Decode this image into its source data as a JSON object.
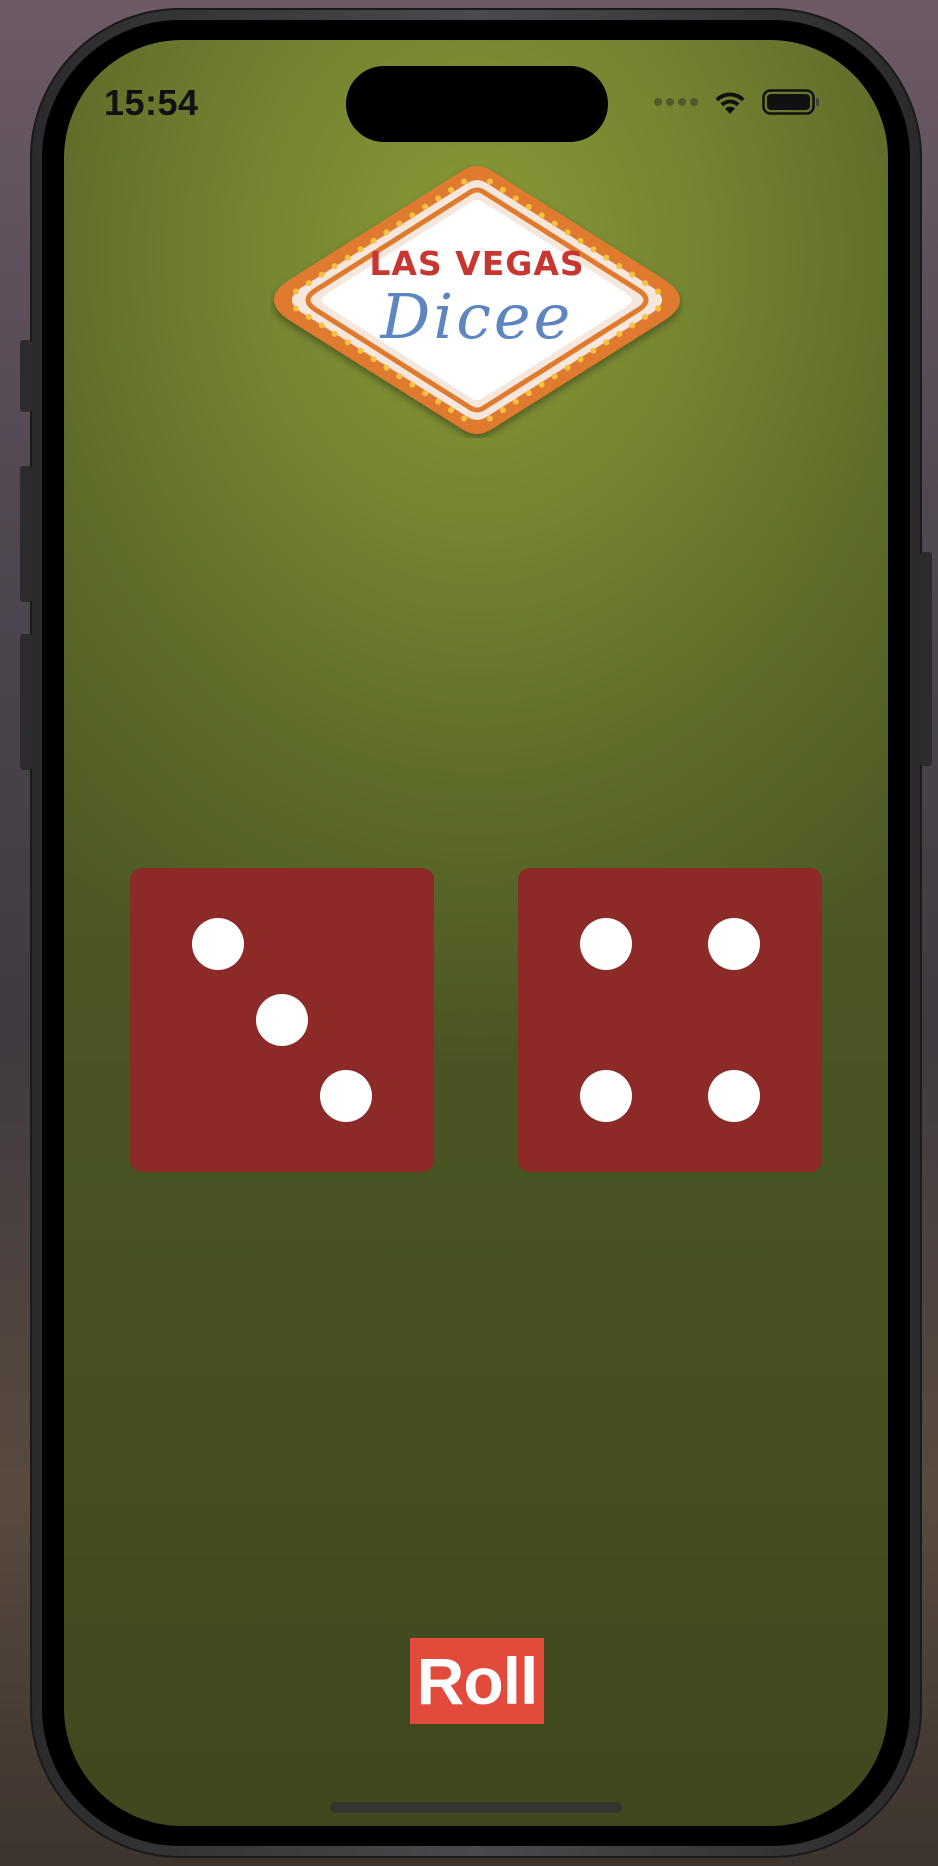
{
  "status_bar": {
    "time": "15:54",
    "wifi_icon": "wifi-icon",
    "battery_icon": "battery-icon",
    "cellular_icon": "cellular-signal-icon"
  },
  "logo": {
    "title": "LAS VEGAS",
    "subtitle": "Dicee",
    "colors": {
      "title": "#c7372f",
      "subtitle": "#5d86c0",
      "border": "#e07a2e",
      "bulbs": "#f5c242"
    }
  },
  "dice": [
    {
      "name": "left-die",
      "value": 3
    },
    {
      "name": "right-die",
      "value": 4
    }
  ],
  "roll_button": {
    "label": "Roll",
    "color": "#e24a3c"
  },
  "colors": {
    "felt": "#748430",
    "die_face": "#8b2a26",
    "pip": "#ffffff"
  }
}
